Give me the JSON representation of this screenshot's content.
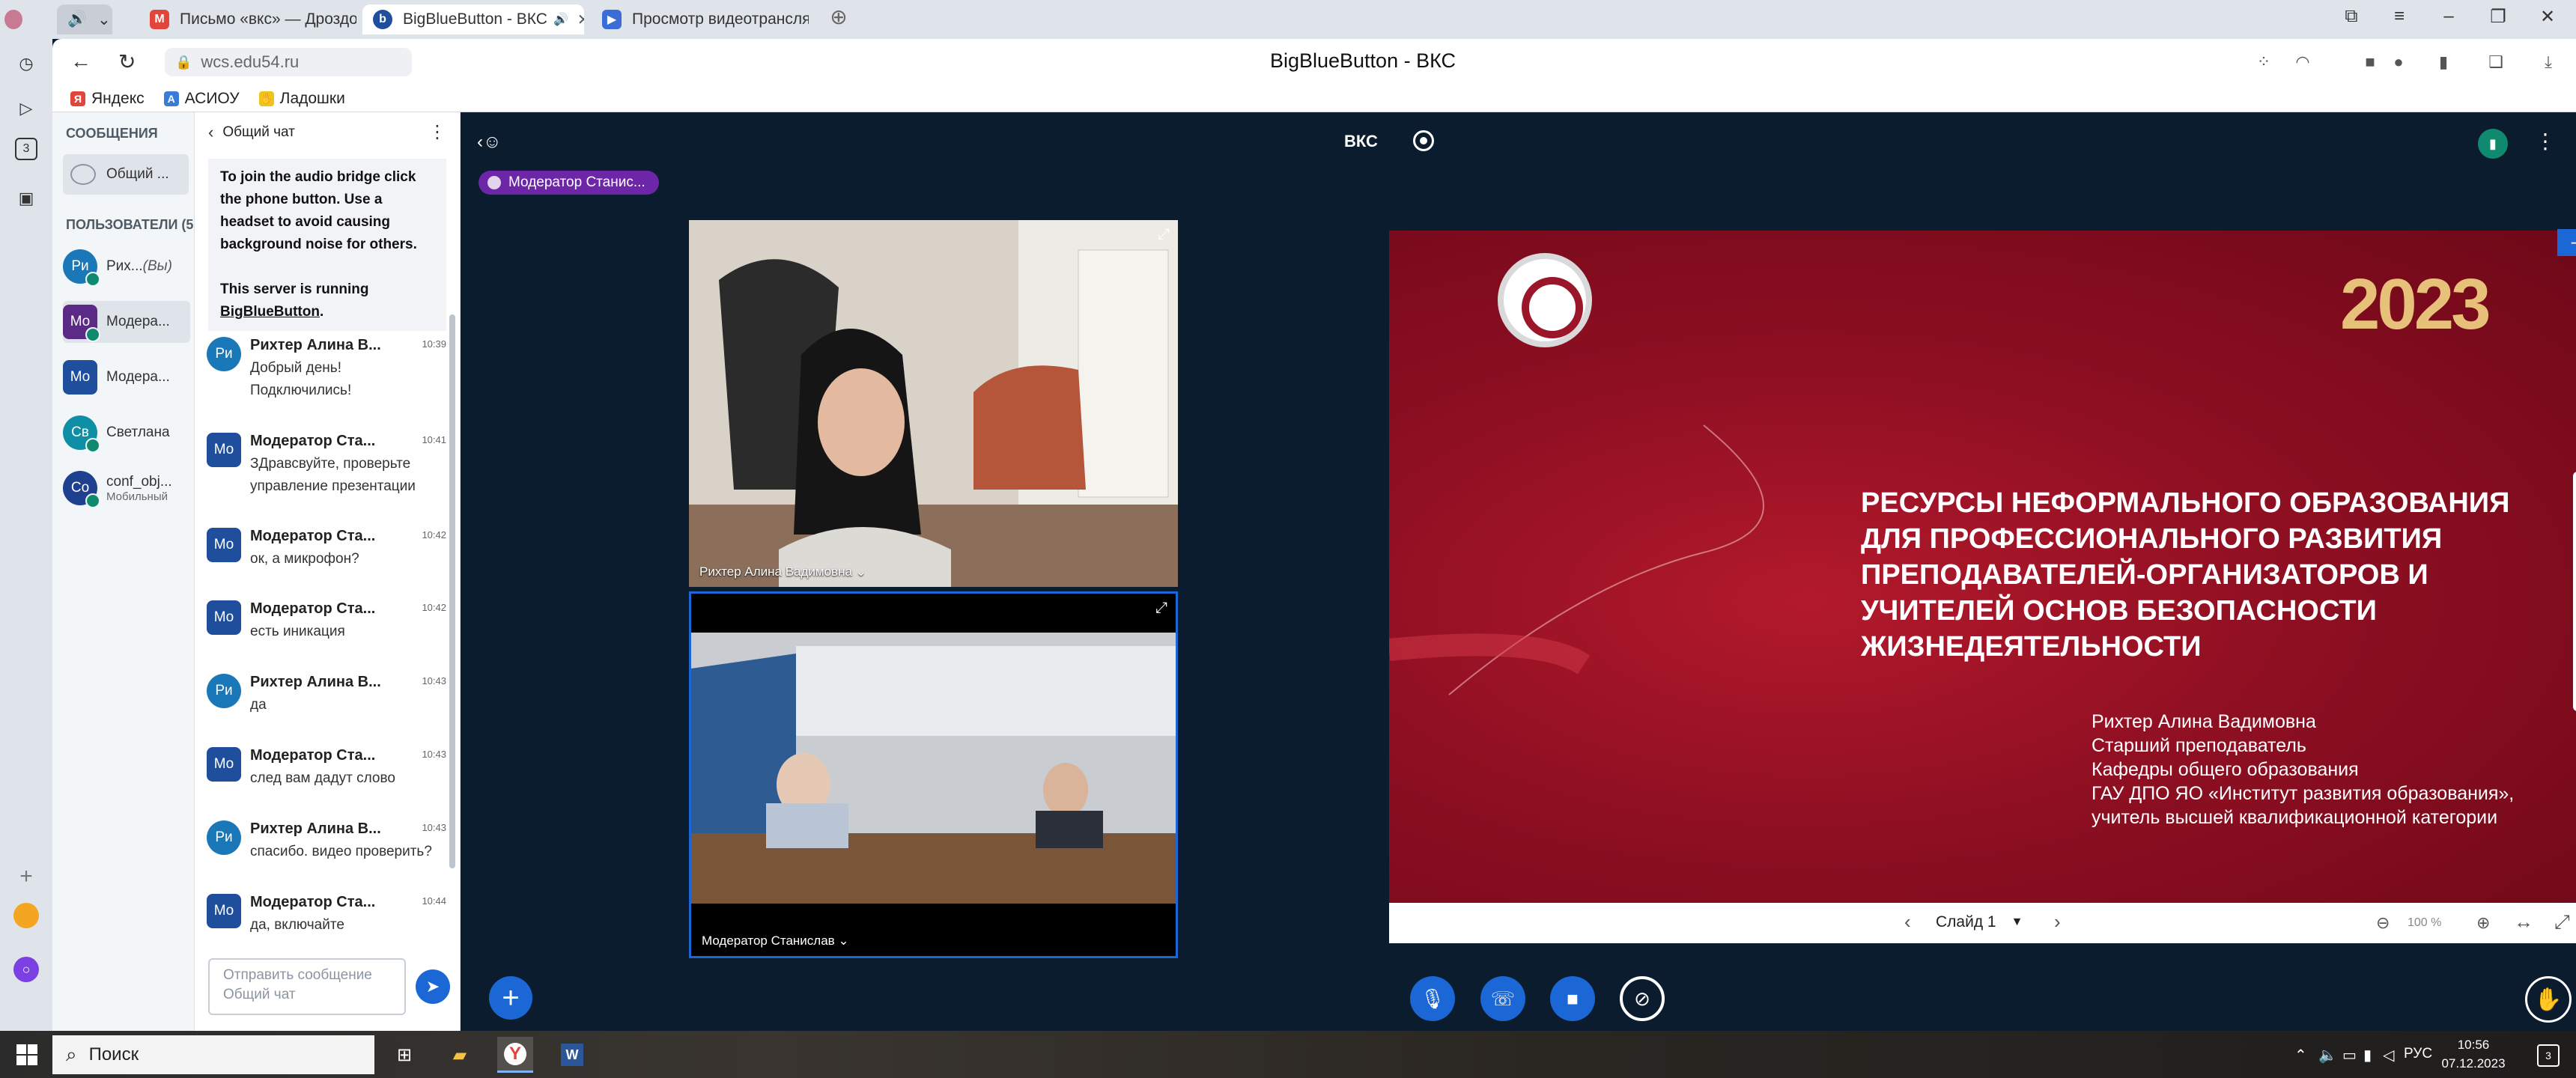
{
  "browser": {
    "tabs": [
      {
        "title": "Письмо «вкс» — Дроздо",
        "icon": "gmail-icon",
        "active": false
      },
      {
        "title": "BigBlueButton - ВКС",
        "icon": "bbb-icon",
        "active": true
      },
      {
        "title": "Просмотр видеотрансляц",
        "icon": "video-icon",
        "active": false
      }
    ],
    "url": "wcs.edu54.ru",
    "page_title": "BigBlueButton - ВКС",
    "bookmarks": [
      {
        "label": "Яндекс",
        "icon": "yandex-icon"
      },
      {
        "label": "АСИОУ",
        "icon": "asiou-icon"
      },
      {
        "label": "Ладошки",
        "icon": "hand-icon"
      }
    ],
    "rail_badge": "3"
  },
  "userlist": {
    "messages_heading": "СООБЩЕНИЯ",
    "public_chat_label": "Общий ...",
    "users_heading": "ПОЛЬЗОВАТЕЛИ (5",
    "users": [
      {
        "initials": "Ри",
        "name": "Рих...",
        "suffix": "(Вы)",
        "sub": "",
        "color": "#1a77b8",
        "shape": "round"
      },
      {
        "initials": "Mo",
        "name": "Модера...",
        "suffix": "",
        "sub": "",
        "color": "#5b2a86",
        "shape": "square"
      },
      {
        "initials": "Mo",
        "name": "Модера...",
        "suffix": "",
        "sub": "",
        "color": "#1f4f9c",
        "shape": "square"
      },
      {
        "initials": "Св",
        "name": "Светлана",
        "suffix": "",
        "sub": "",
        "color": "#0f8fa6",
        "shape": "round"
      },
      {
        "initials": "Co",
        "name": "conf_obj...",
        "suffix": "",
        "sub": "Мобильный",
        "color": "#1f3f8f",
        "shape": "round"
      }
    ]
  },
  "chat": {
    "title": "Общий чат",
    "welcome_1": "To join the audio bridge click the phone button. Use a headset to avoid causing background noise for others.",
    "welcome_2_prefix": "This server is running ",
    "welcome_2_link": "BigBlueButton",
    "welcome_2_suffix": ".",
    "messages": [
      {
        "initials": "Ри",
        "author": "Рихтер Алина В...",
        "time": "10:39",
        "text": "Добрый день! Подключились!",
        "color": "#1a77b8",
        "shape": "round"
      },
      {
        "initials": "Mo",
        "author": "Модератор Ста...",
        "time": "10:41",
        "text": "ЗДравсвуйте, проверьте управление презентации",
        "color": "#1f4f9c",
        "shape": "square"
      },
      {
        "initials": "Mo",
        "author": "Модератор Ста...",
        "time": "10:42",
        "text": "ок, а микрофон?",
        "color": "#1f4f9c",
        "shape": "square"
      },
      {
        "initials": "Mo",
        "author": "Модератор Ста...",
        "time": "10:42",
        "text": "есть иникация",
        "color": "#1f4f9c",
        "shape": "square"
      },
      {
        "initials": "Ри",
        "author": "Рихтер Алина В...",
        "time": "10:43",
        "text": "да",
        "color": "#1a77b8",
        "shape": "round"
      },
      {
        "initials": "Mo",
        "author": "Модератор Ста...",
        "time": "10:43",
        "text": "след вам дадут слово",
        "color": "#1f4f9c",
        "shape": "square"
      },
      {
        "initials": "Ри",
        "author": "Рихтер Алина В...",
        "time": "10:43",
        "text": "спасибо. видео проверить?",
        "color": "#1a77b8",
        "shape": "round"
      },
      {
        "initials": "Mo",
        "author": "Модератор Ста...",
        "time": "10:44",
        "text": "да, включайте",
        "color": "#1f4f9c",
        "shape": "square"
      }
    ],
    "input_placeholder": "Отправить сообщение Общий чат"
  },
  "stage": {
    "meeting_title": "ВКС",
    "talking_indicator": "Модератор Станис...",
    "videos": [
      {
        "name": "Рихтер Алина Вадимовна"
      },
      {
        "name": "Модератор Станислав"
      }
    ]
  },
  "slide": {
    "title": "Ресурсы неформального образования для профессионального развития преподавателей-организаторов и учителей основ безопасности жизнедеятельности",
    "author_lines": [
      "Рихтер Алина Вадимовна",
      "Старший преподаватель",
      "Кафедры общего образования",
      "ГАУ ДПО ЯО «Институт развития образования»,",
      "учитель высшей квалификационной категории"
    ],
    "year_badge": "2023",
    "slide_selector": "Слайд 1",
    "zoom": "100 %",
    "bg_color": "#8e0f22"
  },
  "taskbar": {
    "search_placeholder": "Поиск",
    "lang": "РУС",
    "time": "10:56",
    "date": "07.12.2023",
    "notifications": "3"
  }
}
